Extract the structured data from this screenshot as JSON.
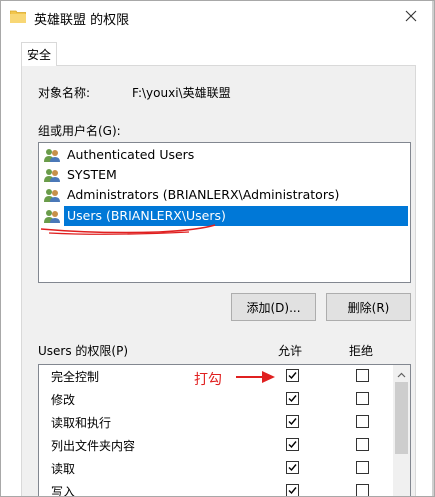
{
  "window": {
    "title": "英雄联盟 的权限"
  },
  "tabs": [
    {
      "label": "安全"
    }
  ],
  "object": {
    "label": "对象名称:",
    "value": "F:\\youxi\\英雄联盟"
  },
  "groups": {
    "label": "组或用户名(G):",
    "items": [
      {
        "label": "Authenticated Users"
      },
      {
        "label": "SYSTEM"
      },
      {
        "label": "Administrators (BRIANLERX\\Administrators)"
      },
      {
        "label": "Users (BRIANLERX\\Users)",
        "selected": true
      }
    ]
  },
  "buttons": {
    "add": "添加(D)...",
    "remove": "删除(R)"
  },
  "permissions": {
    "label": "Users 的权限(P)",
    "allow_header": "允许",
    "deny_header": "拒绝",
    "rows": [
      {
        "name": "完全控制",
        "allow": true,
        "deny": false
      },
      {
        "name": "修改",
        "allow": true,
        "deny": false
      },
      {
        "name": "读取和执行",
        "allow": true,
        "deny": false
      },
      {
        "name": "列出文件夹内容",
        "allow": true,
        "deny": false
      },
      {
        "name": "读取",
        "allow": true,
        "deny": false
      },
      {
        "name": "写入",
        "allow": true,
        "deny": false
      }
    ]
  },
  "annotation": {
    "text": "打勾",
    "color": "#e02020"
  },
  "colors": {
    "selection": "#0078d7",
    "folder": "#f2c64d"
  },
  "icons": {
    "folder": "folder-icon",
    "close": "close-icon",
    "users": "users-group-icon",
    "check": "checkmark-icon",
    "scroll_up": "chevron-up-icon"
  }
}
